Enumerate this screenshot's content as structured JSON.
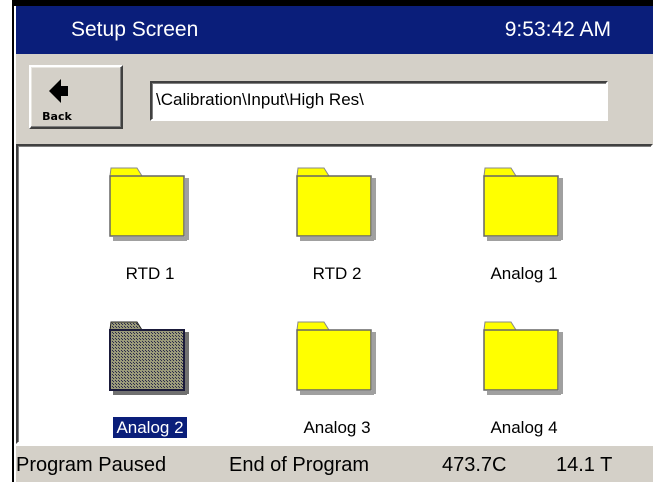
{
  "titlebar": {
    "title": "Setup Screen",
    "clock": "9:53:42 AM"
  },
  "toolbar": {
    "back_label": "Back",
    "path": "\\Calibration\\Input\\High Res\\"
  },
  "folders": [
    {
      "label": "RTD 1",
      "selected": false,
      "icon": "folder-icon"
    },
    {
      "label": "RTD 2",
      "selected": false,
      "icon": "folder-icon"
    },
    {
      "label": "Analog 1",
      "selected": false,
      "icon": "folder-icon"
    },
    {
      "label": "Analog 2",
      "selected": true,
      "icon": "folder-icon"
    },
    {
      "label": "Analog 3",
      "selected": false,
      "icon": "folder-icon"
    },
    {
      "label": "Analog 4",
      "selected": false,
      "icon": "folder-icon"
    }
  ],
  "status": {
    "program_state": "Program Paused",
    "program_step": "End of Program",
    "temperature": "473.7C",
    "reading": "14.1 T"
  },
  "colors": {
    "titlebar_bg": "#0a1e7a",
    "folder_fill": "#ffff00",
    "folder_selected_fill": "#8a8a6a",
    "panel_bg": "#d4d0c8"
  }
}
